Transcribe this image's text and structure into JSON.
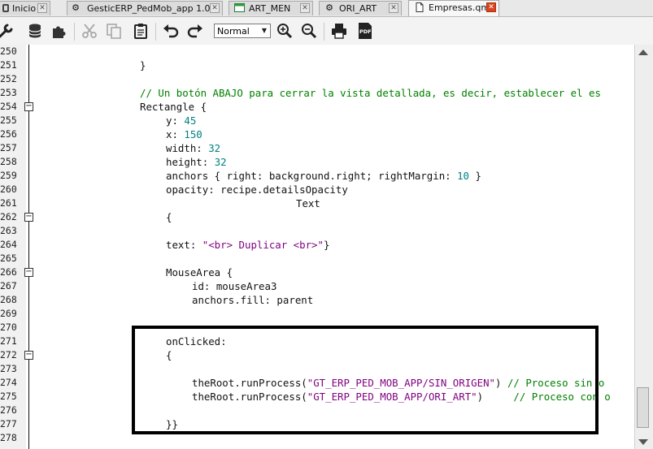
{
  "tabs": [
    {
      "label": "Inicio",
      "icon": "app-icon",
      "active": false
    },
    {
      "label": "GesticERP_PedMob_app 1.0",
      "icon": "gear-icon",
      "active": false
    },
    {
      "label": "ART_MEN",
      "icon": "form-icon",
      "active": false
    },
    {
      "label": "ORI_ART",
      "icon": "gear-icon",
      "active": false
    },
    {
      "label": "Empresas.qml",
      "icon": "document-icon",
      "active": true
    }
  ],
  "toolbar": {
    "buttons": [
      "wrench-icon",
      "database-icon",
      "puzzle-icon",
      "cut-icon",
      "copy-icon",
      "paste-icon",
      "undo-icon",
      "redo-icon",
      "zoom-in-icon",
      "zoom-out-icon",
      "print-icon",
      "pdf-icon"
    ],
    "zoom_value": "Normal",
    "pdf_label": "PDF"
  },
  "gutter": {
    "line_numbers": [
      "250",
      "251",
      "252",
      "253",
      "254",
      "255",
      "256",
      "257",
      "258",
      "259",
      "260",
      "261",
      "262",
      "263",
      "264",
      "265",
      "266",
      "267",
      "268",
      "269",
      "270",
      "271",
      "272",
      "273",
      "274",
      "275",
      "276",
      "277",
      "278"
    ],
    "fold_markers": [
      "254",
      "262",
      "266",
      "272"
    ]
  },
  "code": {
    "l250": "}",
    "l253": "// Un botón ABAJO para cerrar la vista detallada, es decir, establecer el es",
    "l254": "Rectangle {",
    "l255a": "y: ",
    "l255b": "45",
    "l256a": "x: ",
    "l256b": "150",
    "l257a": "width: ",
    "l257b": "32",
    "l258a": "height: ",
    "l258b": "32",
    "l259a": "anchors { right: background.right; rightMargin: ",
    "l259b": "10",
    "l259c": " }",
    "l260": "opacity: recipe.detailsOpacity",
    "l261": "Text",
    "l262": "{",
    "l264a": "text: ",
    "l264b": "\"<br> Duplicar <br>\"",
    "l264c": "}",
    "l266": "MouseArea {",
    "l267": "id: mouseArea3",
    "l268": "anchors.fill: parent",
    "l271": "onClicked:",
    "l272": "{",
    "l274a": "theRoot.runProcess(",
    "l274b": "\"GT_ERP_PED_MOB_APP/SIN_ORIGEN\"",
    "l274c": ") ",
    "l274d": "// Proceso sin o",
    "l275a": "theRoot.runProcess(",
    "l275b": "\"GT_ERP_PED_MOB_APP/ORI_ART\"",
    "l275c": ")     ",
    "l275d": "// Proceso con o",
    "l277": "}}"
  }
}
